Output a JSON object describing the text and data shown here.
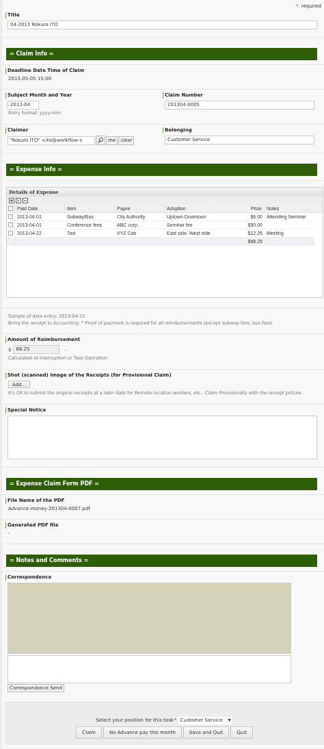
{
  "required_note": {
    "mark": "*",
    "text": ": required"
  },
  "sections": [
    {
      "kind": "field",
      "label": "Title",
      "value": "04-2013 Rokuro ITO"
    },
    {
      "kind": "header",
      "text": "= Claim Info ="
    },
    {
      "kind": "text",
      "label": "Deadline Date Time of Claim",
      "value": "2013-05-05 15:00"
    },
    {
      "kind": "pair",
      "left": {
        "label": "Subject Month and Year",
        "value": "2013-04",
        "hint": "Entry format: yyyy-mm"
      },
      "right": {
        "label": "Claim Number",
        "value": "201304-0005"
      }
    },
    {
      "kind": "claimer",
      "left": {
        "label": "Claimer",
        "value": "\"Rokuro ITO\" <ito@workflow-s",
        "buttons": [
          "me",
          "clear"
        ]
      },
      "right": {
        "label": "Belonging",
        "value": "Customer Service"
      }
    },
    {
      "kind": "header",
      "text": "= Expense Info ="
    },
    {
      "kind": "table",
      "title": "Details of Expense",
      "header_checked": false,
      "columns": [
        "Paid Date",
        "Item",
        "Payee",
        "Adoption",
        "Price",
        "Notes"
      ],
      "rows": [
        {
          "checked": false,
          "cells": [
            "2013-04-01",
            "Subway/Bus",
            "City Authority",
            "Uptown-Downtoun",
            "$6.00",
            "Attending Seminar"
          ]
        },
        {
          "checked": false,
          "cells": [
            "2013-04-01",
            "Conference fees",
            "ABC corp.",
            "Seminar fee",
            "$50.00",
            ""
          ]
        },
        {
          "checked": false,
          "cells": [
            "2013-04-22",
            "Taxi",
            "XYZ Cab",
            "East side- West side",
            "$12.25",
            "Meeting"
          ]
        }
      ],
      "total": "$68.25"
    },
    {
      "kind": "notes",
      "lines": [
        "Sample of date entry; 2013-04-15",
        "Bring the receipt to Accounting. * Proof of payment is required for all reimbursements (except subway fare, bus fare)"
      ]
    },
    {
      "kind": "amount",
      "label": "Amount of Reimbursement",
      "currency": "$",
      "value": "68.25",
      "suffix": "-",
      "hint": "Calculated at Interruption or Task Operation"
    },
    {
      "kind": "upload",
      "label": "Shot (scanned) Image of the Receipts (for Provisional Claim)",
      "button": "Add...",
      "hint": "It's OK to submit the original receipts at a later date for Remote location workers, etc.. Claim Provisionally with the receipt picture."
    },
    {
      "kind": "textarea",
      "label": "Special Notice"
    },
    {
      "kind": "header",
      "text": "= Expense Claim Form PDF ="
    },
    {
      "kind": "text",
      "label": "File Name of the PDF",
      "value": "Advance-money-201304-0007.pdf"
    },
    {
      "kind": "text",
      "label": "Generated PDF file",
      "value": "-"
    },
    {
      "kind": "header",
      "text": "= Notes and Comments ="
    },
    {
      "kind": "correspondence",
      "label": "Correspondence",
      "button": "Correspondence Send"
    }
  ],
  "footer": {
    "select_label": "Select your position for this task",
    "required_mark": "*",
    "select_value": "Customer Service",
    "buttons": [
      "Claim",
      "No Advance pay this month",
      "Save and Quit",
      "Quit"
    ]
  }
}
